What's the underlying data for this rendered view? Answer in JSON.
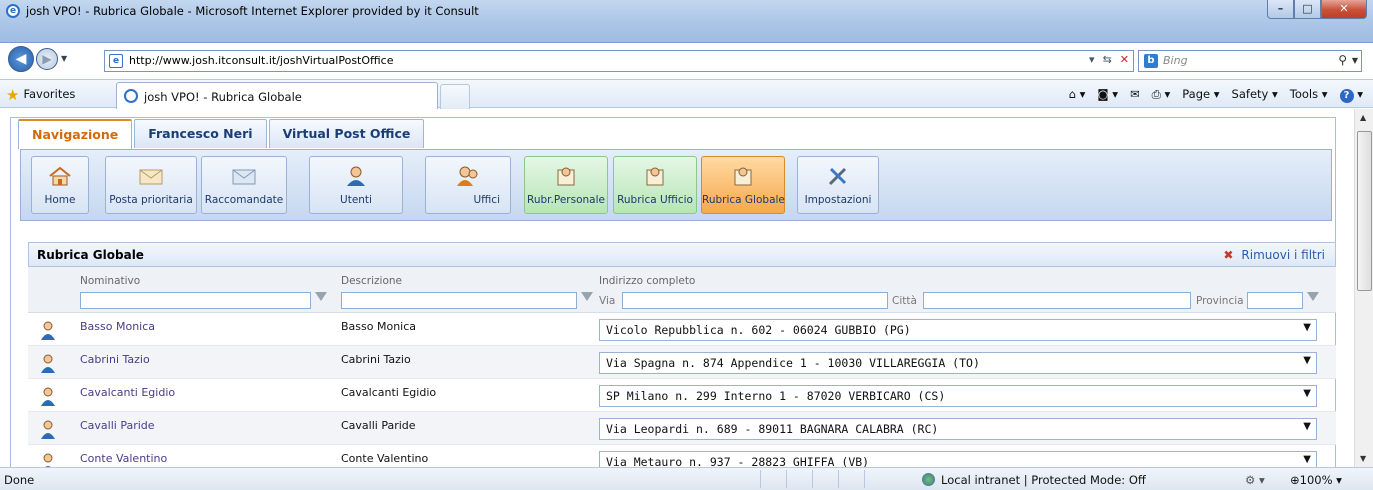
{
  "window": {
    "title": "josh VPO! - Rubrica Globale - Microsoft Internet Explorer provided by it Consult",
    "min": "–",
    "max": "□",
    "close": "✕"
  },
  "browser": {
    "url": "http://www.josh.itconsult.it/joshVirtualPostOffice",
    "search_placeholder": "Bing",
    "favorites_label": "Favorites",
    "tab_title": "josh VPO! - Rubrica Globale",
    "commands": {
      "page": "Page",
      "safety": "Safety",
      "tools": "Tools"
    }
  },
  "app": {
    "tabs": [
      "Navigazione",
      "Francesco Neri",
      "Virtual Post Office"
    ],
    "ribbon": {
      "home": "Home",
      "posta": "Posta prioritaria",
      "racc": "Raccomandate",
      "utenti": "Utenti",
      "uffici": "Uffici",
      "rubr_pers": "Rubr.Personale",
      "rubr_uff": "Rubrica Ufficio",
      "rubr_glob": "Rubrica Globale",
      "impost": "Impostazioni"
    },
    "section_title": "Rubrica Globale",
    "remove_filters": "Rimuovi i filtri",
    "columns": {
      "nominativo": "Nominativo",
      "descrizione": "Descrizione",
      "indirizzo": "Indirizzo completo",
      "via": "Via",
      "citta": "Città",
      "provincia": "Provincia"
    },
    "rows": [
      {
        "name": "Basso Monica",
        "desc": "Basso Monica",
        "addr": "Vicolo Repubblica n. 602 - 06024 GUBBIO (PG)"
      },
      {
        "name": "Cabrini Tazio",
        "desc": "Cabrini Tazio",
        "addr": "Via Spagna n. 874 Appendice 1 - 10030 VILLAREGGIA (TO)"
      },
      {
        "name": "Cavalcanti Egidio",
        "desc": "Cavalcanti Egidio",
        "addr": "SP Milano n. 299 Interno 1 - 87020 VERBICARO (CS)"
      },
      {
        "name": "Cavalli Paride",
        "desc": "Cavalli Paride",
        "addr": "Via Leopardi n. 689 - 89011 BAGNARA CALABRA (RC)"
      },
      {
        "name": "Conte Valentino",
        "desc": "Conte Valentino",
        "addr": "Via Metauro n. 937 - 28823 GHIFFA (VB)"
      }
    ]
  },
  "status": {
    "done": "Done",
    "zone": "Local intranet | Protected Mode: Off",
    "zoom": "100%"
  },
  "colors": {
    "accent": "#e08a20",
    "link": "#4b3a8a",
    "ribbon_active": "#f7a94c"
  }
}
